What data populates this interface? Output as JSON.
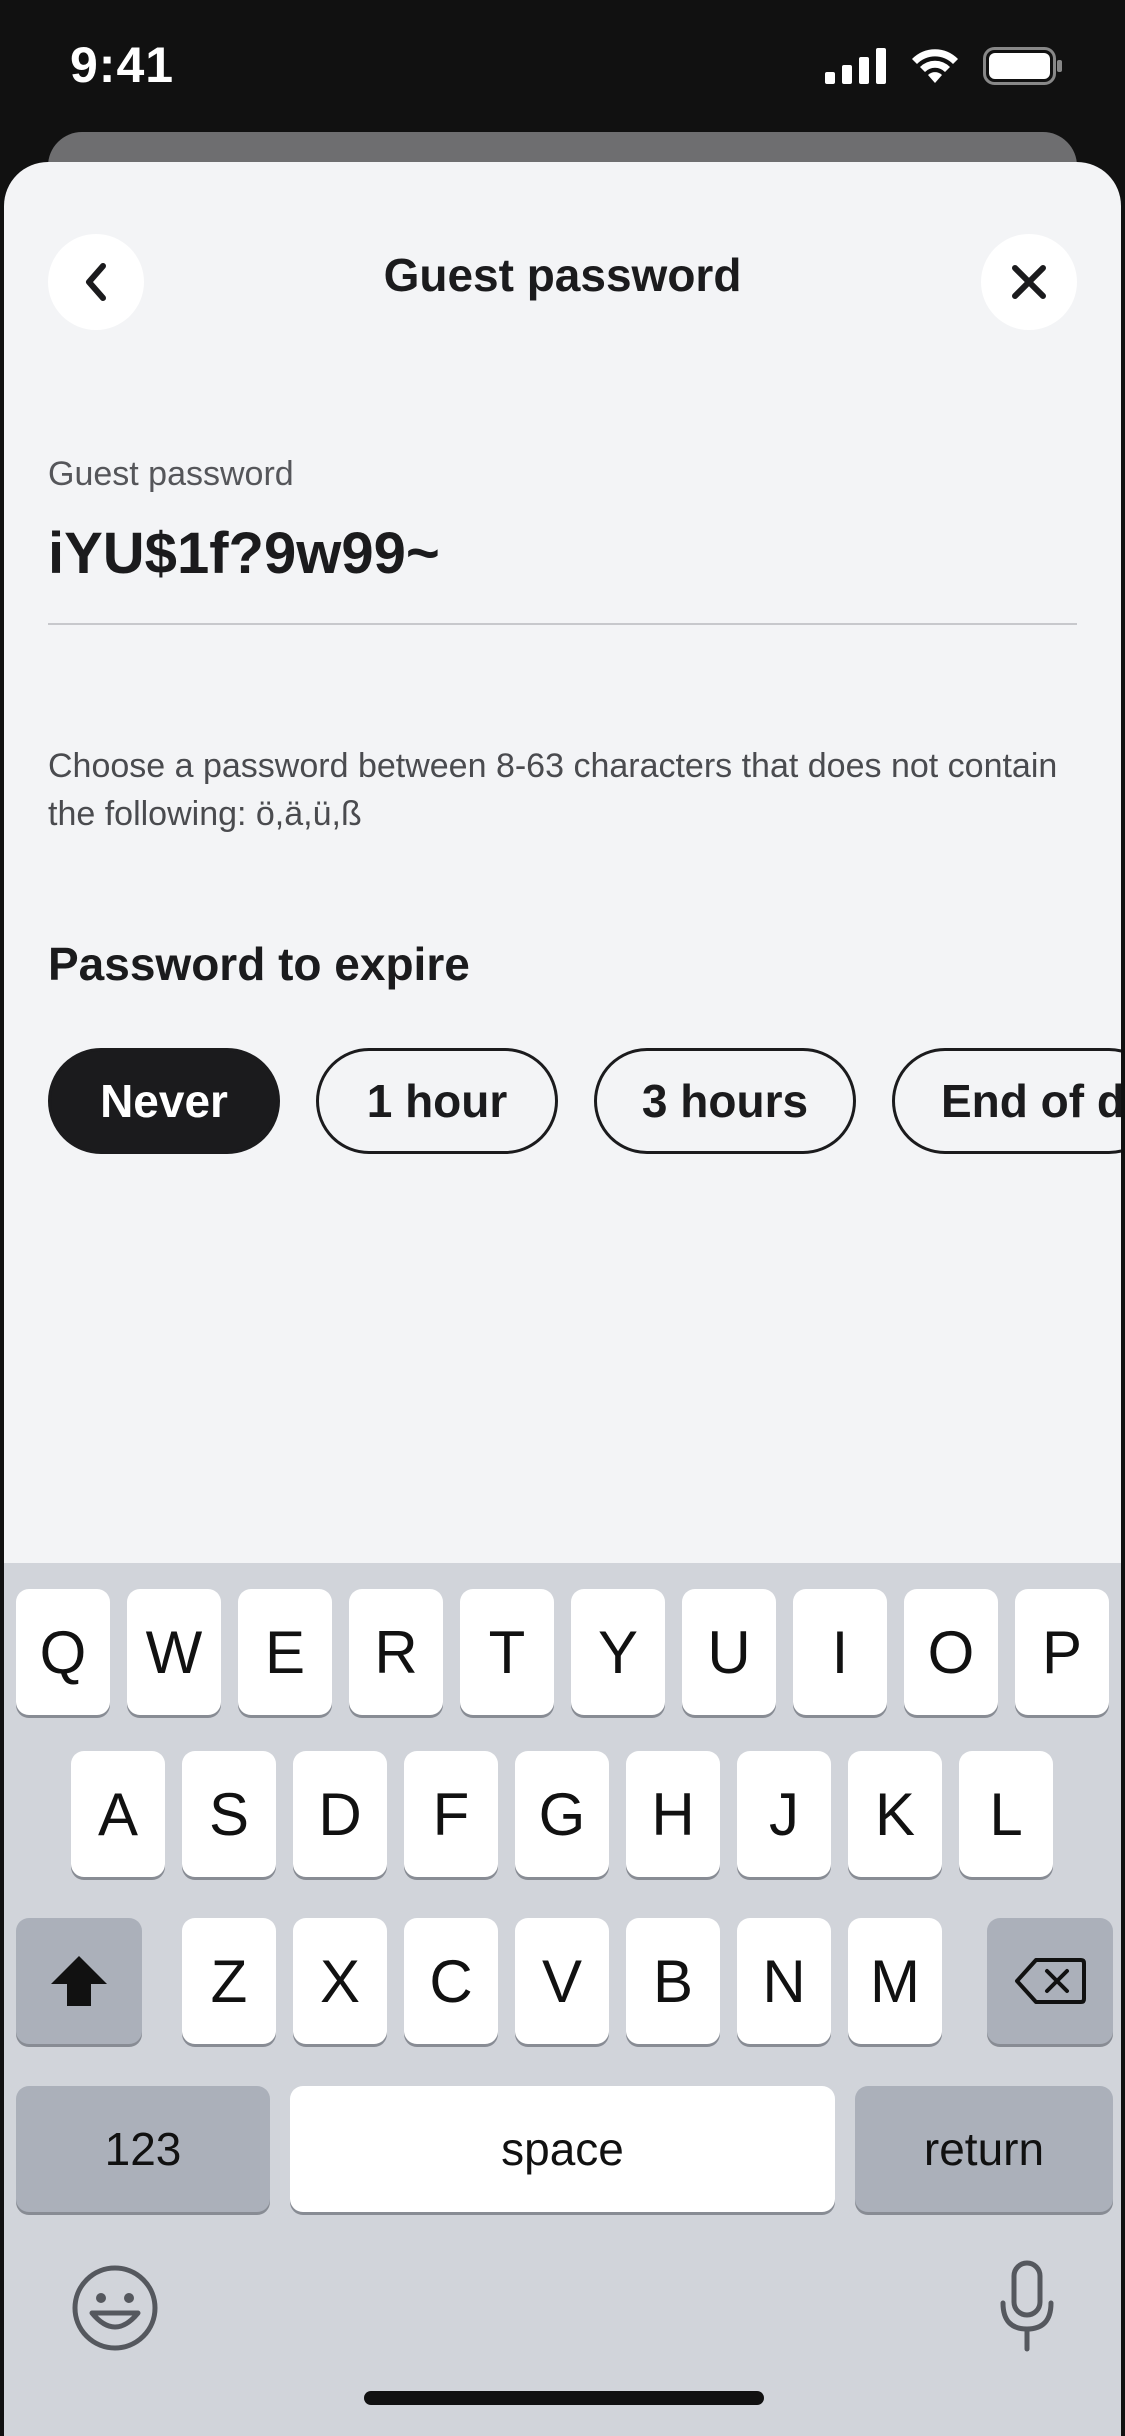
{
  "status_bar": {
    "time": "9:41"
  },
  "header": {
    "title": "Guest password"
  },
  "password_field": {
    "label": "Guest password",
    "value": "iYU$1f?9w99~"
  },
  "hint": "Choose a password between 8-63 characters that does not contain the following: ö,ä,ü,ß",
  "expire": {
    "title": "Password to expire",
    "options": [
      "Never",
      "1 hour",
      "3 hours",
      "End of d"
    ],
    "selected": "Never"
  },
  "keyboard": {
    "row1": [
      "Q",
      "W",
      "E",
      "R",
      "T",
      "Y",
      "U",
      "I",
      "O",
      "P"
    ],
    "row2": [
      "A",
      "S",
      "D",
      "F",
      "G",
      "H",
      "J",
      "K",
      "L"
    ],
    "row3": [
      "Z",
      "X",
      "C",
      "V",
      "B",
      "N",
      "M"
    ],
    "numbers_label": "123",
    "space_label": "space",
    "return_label": "return"
  },
  "icons": {
    "signal": "cellular-signal-icon",
    "wifi": "wifi-icon",
    "battery": "battery-icon",
    "back": "chevron-left-icon",
    "close": "close-icon",
    "shift": "shift-icon",
    "delete": "delete-icon",
    "emoji": "emoji-icon",
    "mic": "microphone-icon"
  },
  "colors": {
    "sheet_background": "#f3f4f6",
    "selected_chip": "#1b1b1d",
    "keyboard_background": "#d1d4da"
  }
}
